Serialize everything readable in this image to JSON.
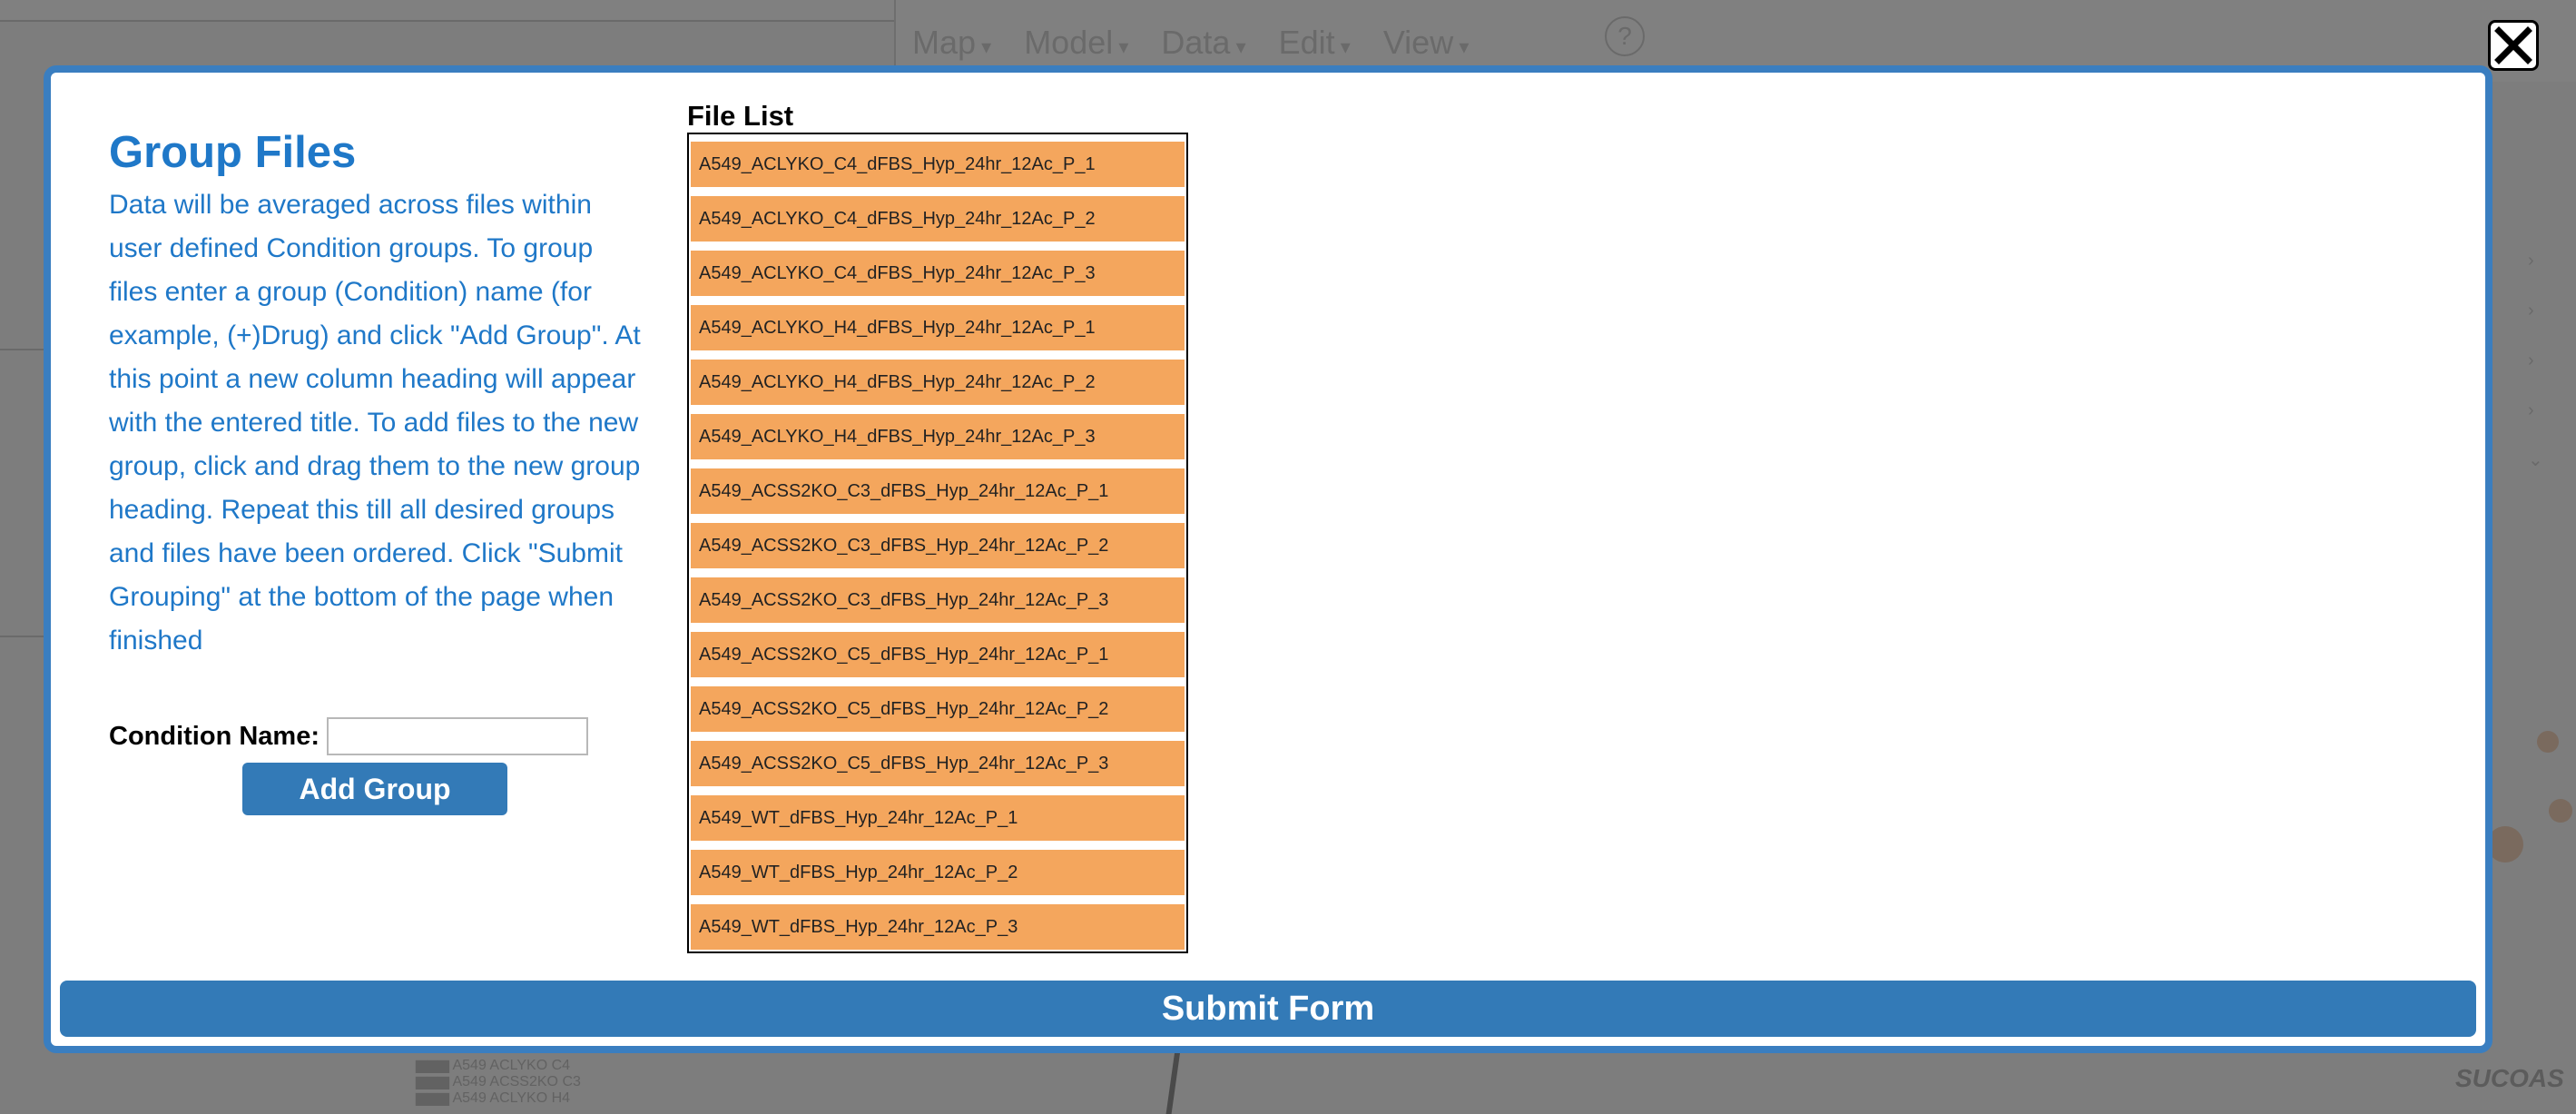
{
  "background": {
    "menu_items": [
      "Map",
      "Model",
      "Data",
      "Edit",
      "View"
    ],
    "help_label": "?",
    "legend_lines": [
      "▆▆▆ A549 ACLYKO C4",
      "▆▆▆ A549 ACSS2KO C3",
      "▆▆▆ A549 ACLYKO H4"
    ],
    "corner_label": "SUCOAS"
  },
  "modal": {
    "title": "Group Files",
    "description": "Data will be averaged across files within user defined Condition groups. To group files enter a group (Condition) name (for example, (+)Drug) and click \"Add Group\". At this point a new column heading will appear with the entered title. To add files to the new group, click and drag them to the new group heading. Repeat this till all desired groups and files have been ordered. Click \"Submit Grouping\" at the bottom of the page when finished",
    "condition_label": "Condition Name:",
    "condition_value": "",
    "add_group_label": "Add Group",
    "file_list_title": "File List",
    "files": [
      "A549_ACLYKO_C4_dFBS_Hyp_24hr_12Ac_P_1",
      "A549_ACLYKO_C4_dFBS_Hyp_24hr_12Ac_P_2",
      "A549_ACLYKO_C4_dFBS_Hyp_24hr_12Ac_P_3",
      "A549_ACLYKO_H4_dFBS_Hyp_24hr_12Ac_P_1",
      "A549_ACLYKO_H4_dFBS_Hyp_24hr_12Ac_P_2",
      "A549_ACLYKO_H4_dFBS_Hyp_24hr_12Ac_P_3",
      "A549_ACSS2KO_C3_dFBS_Hyp_24hr_12Ac_P_1",
      "A549_ACSS2KO_C3_dFBS_Hyp_24hr_12Ac_P_2",
      "A549_ACSS2KO_C3_dFBS_Hyp_24hr_12Ac_P_3",
      "A549_ACSS2KO_C5_dFBS_Hyp_24hr_12Ac_P_1",
      "A549_ACSS2KO_C5_dFBS_Hyp_24hr_12Ac_P_2",
      "A549_ACSS2KO_C5_dFBS_Hyp_24hr_12Ac_P_3",
      "A549_WT_dFBS_Hyp_24hr_12Ac_P_1",
      "A549_WT_dFBS_Hyp_24hr_12Ac_P_2",
      "A549_WT_dFBS_Hyp_24hr_12Ac_P_3"
    ],
    "submit_label": "Submit Form"
  },
  "colors": {
    "accent": "#337ab7",
    "title": "#1f78c8",
    "file_item": "#f4a65d",
    "modal_border": "#3a7ec0"
  },
  "icons": {
    "close": "close-icon"
  }
}
